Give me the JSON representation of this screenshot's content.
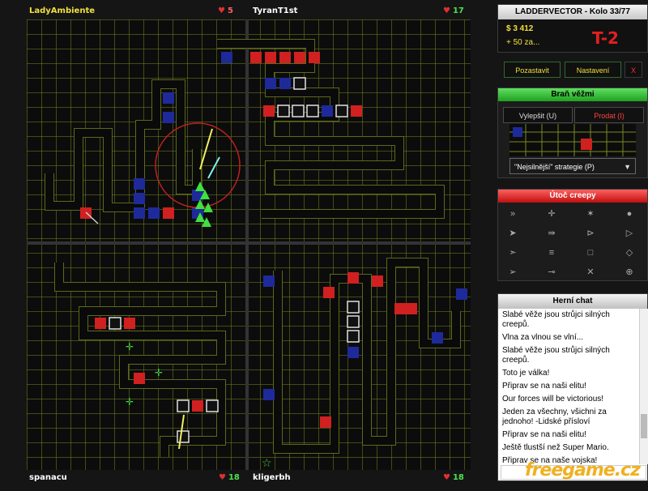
{
  "players": {
    "top_left": {
      "name": "LadyAmbiente",
      "lives": "5"
    },
    "top_right": {
      "name": "TyranT1st",
      "lives": "17"
    },
    "bottom_left": {
      "name": "spanacu",
      "lives": "18"
    },
    "bottom_right": {
      "name": "kligerbh",
      "lives": "18"
    }
  },
  "status": {
    "title": "LADDERVECTOR - Kolo 33/77",
    "money": "$ 3 412",
    "income": "+ 50 za...",
    "tower_code": "T-2"
  },
  "controls": {
    "pause": "Pozastavit",
    "settings": "Nastavení",
    "close": "X"
  },
  "defend": {
    "title": "Braň věžmi",
    "upgrade": "Vylepšit (U)",
    "sell": "Prodat (I)",
    "strategy": "\"Nejsilnější\" strategie (P)"
  },
  "attack": {
    "title": "Útoč creepy"
  },
  "chat": {
    "title": "Herní chat",
    "messages": [
      "Slabé věže jsou strůjci silných creepů.",
      "Vlna za vlnou se vlní...",
      "Slabé věže jsou strůjci silných creepů.",
      "Toto je válka!",
      "Připrav se na naši elitu!",
      "Our forces will be victorious!",
      "Jeden za všechny, všichni za jednoho! -Lidské přísloví",
      "Připrav se na naši elitu!",
      "Ještě tlustší než Super Mario.",
      "Připrav se na naše vojska!"
    ]
  },
  "logo": "freegame.cz",
  "icons": {
    "heart": "heart-icon",
    "dropdown": "chevron-down-icon"
  },
  "colors": {
    "grid": "#7a8a1e",
    "path": "#0a0a0a",
    "red_tower": "#d02020",
    "blue_tower": "#1e2a9a",
    "accent_green": "#30d030"
  }
}
